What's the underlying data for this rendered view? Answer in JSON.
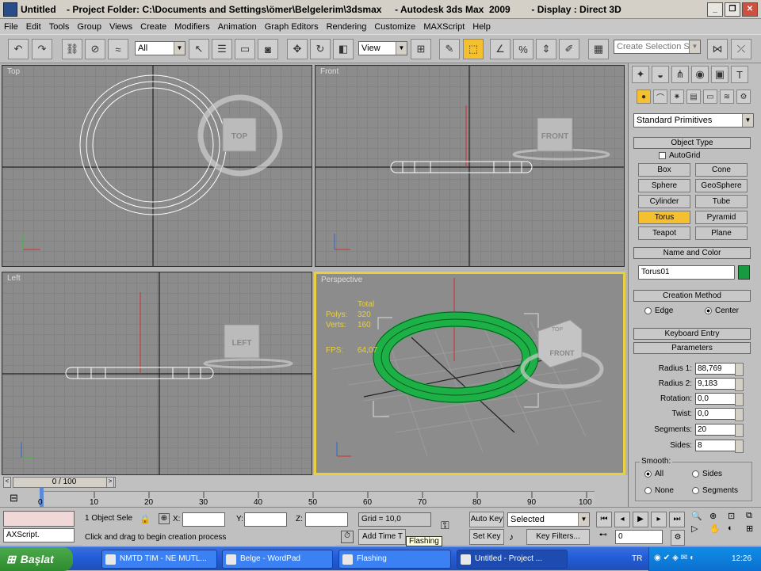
{
  "window": {
    "title": "Untitled    - Project Folder: C:\\Documents and Settings\\ömer\\Belgelerim\\3dsmax     - Autodesk 3ds Max  2009        - Display : Direct 3D"
  },
  "menu": [
    "File",
    "Edit",
    "Tools",
    "Group",
    "Views",
    "Create",
    "Modifiers",
    "Animation",
    "Graph Editors",
    "Rendering",
    "Customize",
    "MAXScript",
    "Help"
  ],
  "toolbar": {
    "selection_filter": "All",
    "ref_coord": "View",
    "named_selection": "Create Selection Set"
  },
  "viewports": {
    "top": "Top",
    "front": "Front",
    "left": "Left",
    "perspective": "Perspective"
  },
  "viewcube": {
    "top": "TOP",
    "front": "FRONT",
    "left": "LEFT",
    "persp_top": "TOP",
    "persp_front": "FRONT"
  },
  "stats": {
    "total": "Total",
    "polys_label": "Polys:",
    "polys": "320",
    "verts_label": "Verts:",
    "verts": "160",
    "fps_label": "FPS:",
    "fps": "64,07"
  },
  "command_panel": {
    "category": "Standard Primitives",
    "object_type_header": "Object Type",
    "autogrid": "AutoGrid",
    "buttons": [
      "Box",
      "Cone",
      "Sphere",
      "GeoSphere",
      "Cylinder",
      "Tube",
      "Torus",
      "Pyramid",
      "Teapot",
      "Plane"
    ],
    "name_color_header": "Name and Color",
    "object_name": "Torus01",
    "object_color": "#1a9a40",
    "creation_method_header": "Creation Method",
    "cm_edge": "Edge",
    "cm_center": "Center",
    "keyboard_entry_header": "Keyboard Entry",
    "parameters_header": "Parameters",
    "params": [
      {
        "label": "Radius 1:",
        "value": "88,769"
      },
      {
        "label": "Radius 2:",
        "value": "9,183"
      },
      {
        "label": "Rotation:",
        "value": "0,0"
      },
      {
        "label": "Twist:",
        "value": "0,0"
      },
      {
        "label": "Segments:",
        "value": "20"
      },
      {
        "label": "Sides:",
        "value": "8"
      }
    ],
    "smooth_label": "Smooth:",
    "smooth_all": "All",
    "smooth_sides": "Sides",
    "smooth_none": "None",
    "smooth_segments": "Segments"
  },
  "timeline": {
    "frame": "0 / 100",
    "ticks": [
      "0",
      "10",
      "20",
      "30",
      "40",
      "50",
      "60",
      "70",
      "80",
      "90",
      "100"
    ]
  },
  "status": {
    "maxscript": "AXScript.",
    "objects_selected": "1 Object Sele",
    "x_label": "X:",
    "y_label": "Y:",
    "z_label": "Z:",
    "grid": "Grid = 10,0",
    "auto_key": "Auto Key",
    "selected": "Selected",
    "set_key": "Set Key",
    "key_filters": "Key Filters...",
    "prompt": "Click and drag to begin creation process",
    "add_time_tag": "Add Time T",
    "tooltip": "Flashing",
    "frame_field": "0"
  },
  "taskbar": {
    "start": "Başlat",
    "tasks": [
      "NMTD TIM - NE MUTL...",
      "Belge - WordPad",
      "Flashing",
      "Untitled    - Project ..."
    ],
    "lang": "TR",
    "clock": "12:26"
  },
  "colors": {
    "torus_selected": "#1db046",
    "wire": "#ffffff",
    "active_border": "#e8d040",
    "axis_red": "#d03030"
  }
}
